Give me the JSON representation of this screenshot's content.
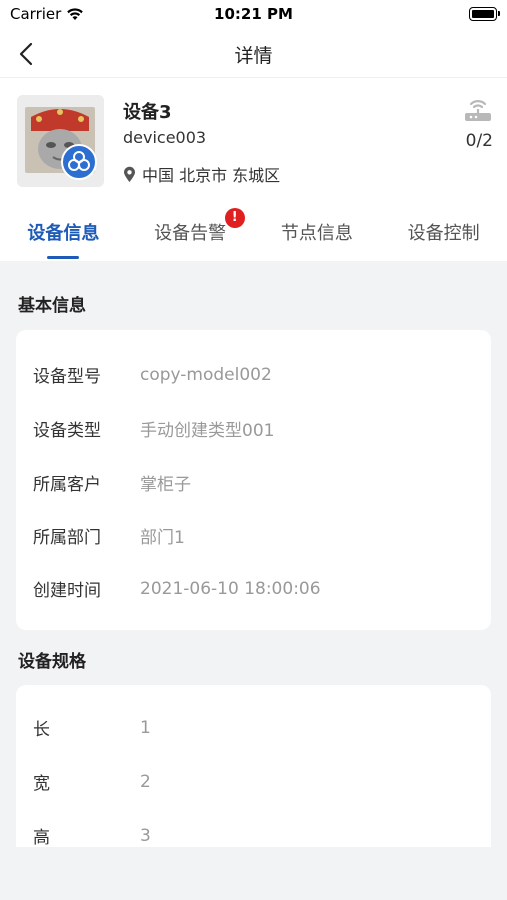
{
  "status_bar": {
    "carrier": "Carrier",
    "time": "10:21 PM"
  },
  "nav": {
    "title": "详情"
  },
  "device": {
    "name": "设备3",
    "code": "device003",
    "location": "中国 北京市 东城区",
    "node_count": "0/2"
  },
  "tabs": [
    {
      "label": "设备信息",
      "active": true
    },
    {
      "label": "设备告警",
      "badge": "!"
    },
    {
      "label": "节点信息"
    },
    {
      "label": "设备控制"
    }
  ],
  "basic_info": {
    "title": "基本信息",
    "rows": [
      {
        "label": "设备型号",
        "value": "copy-model002"
      },
      {
        "label": "设备类型",
        "value": "手动创建类型001"
      },
      {
        "label": "所属客户",
        "value": "掌柜子"
      },
      {
        "label": "所属部门",
        "value": "部门1"
      },
      {
        "label": "创建时间",
        "value": "2021-06-10 18:00:06"
      }
    ]
  },
  "spec": {
    "title": "设备规格",
    "rows": [
      {
        "label": "长",
        "value": "1"
      },
      {
        "label": "宽",
        "value": "2"
      },
      {
        "label": "高",
        "value": "3"
      }
    ]
  },
  "colors": {
    "accent": "#1e5bb8",
    "badge": "#e02020",
    "background": "#f2f3f5"
  }
}
